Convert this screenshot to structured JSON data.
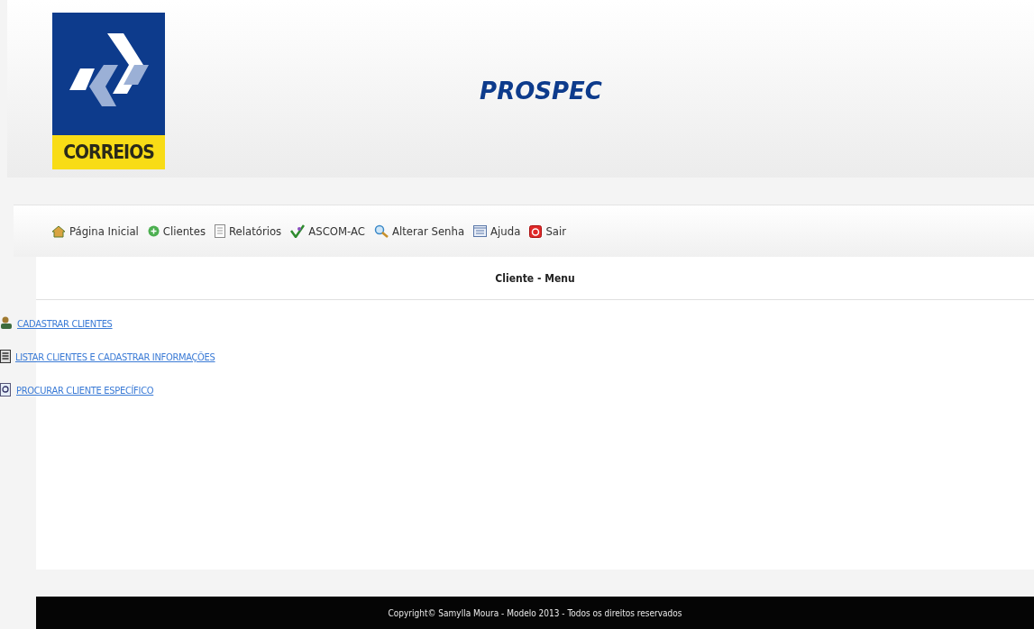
{
  "header": {
    "logo_text": "CORREIOS",
    "title": "PROSPEC"
  },
  "nav": [
    {
      "label": "Página Inicial"
    },
    {
      "label": "Clientes"
    },
    {
      "label": "Relatórios"
    },
    {
      "label": "ASCOM-AC"
    },
    {
      "label": "Alterar Senha"
    },
    {
      "label": "Ajuda"
    },
    {
      "label": "Sair"
    }
  ],
  "panel": {
    "heading": "Cliente - Menu",
    "links": [
      {
        "label": "CADASTRAR CLIENTES"
      },
      {
        "label": "LISTAR CLIENTES E CADASTRAR INFORMAÇÕES"
      },
      {
        "label": "PROCURAR CLIENTE ESPECÍFICO"
      }
    ]
  },
  "footer": "Copyright© Samylla Moura - Modelo 2013 - Todos os direitos reservados"
}
